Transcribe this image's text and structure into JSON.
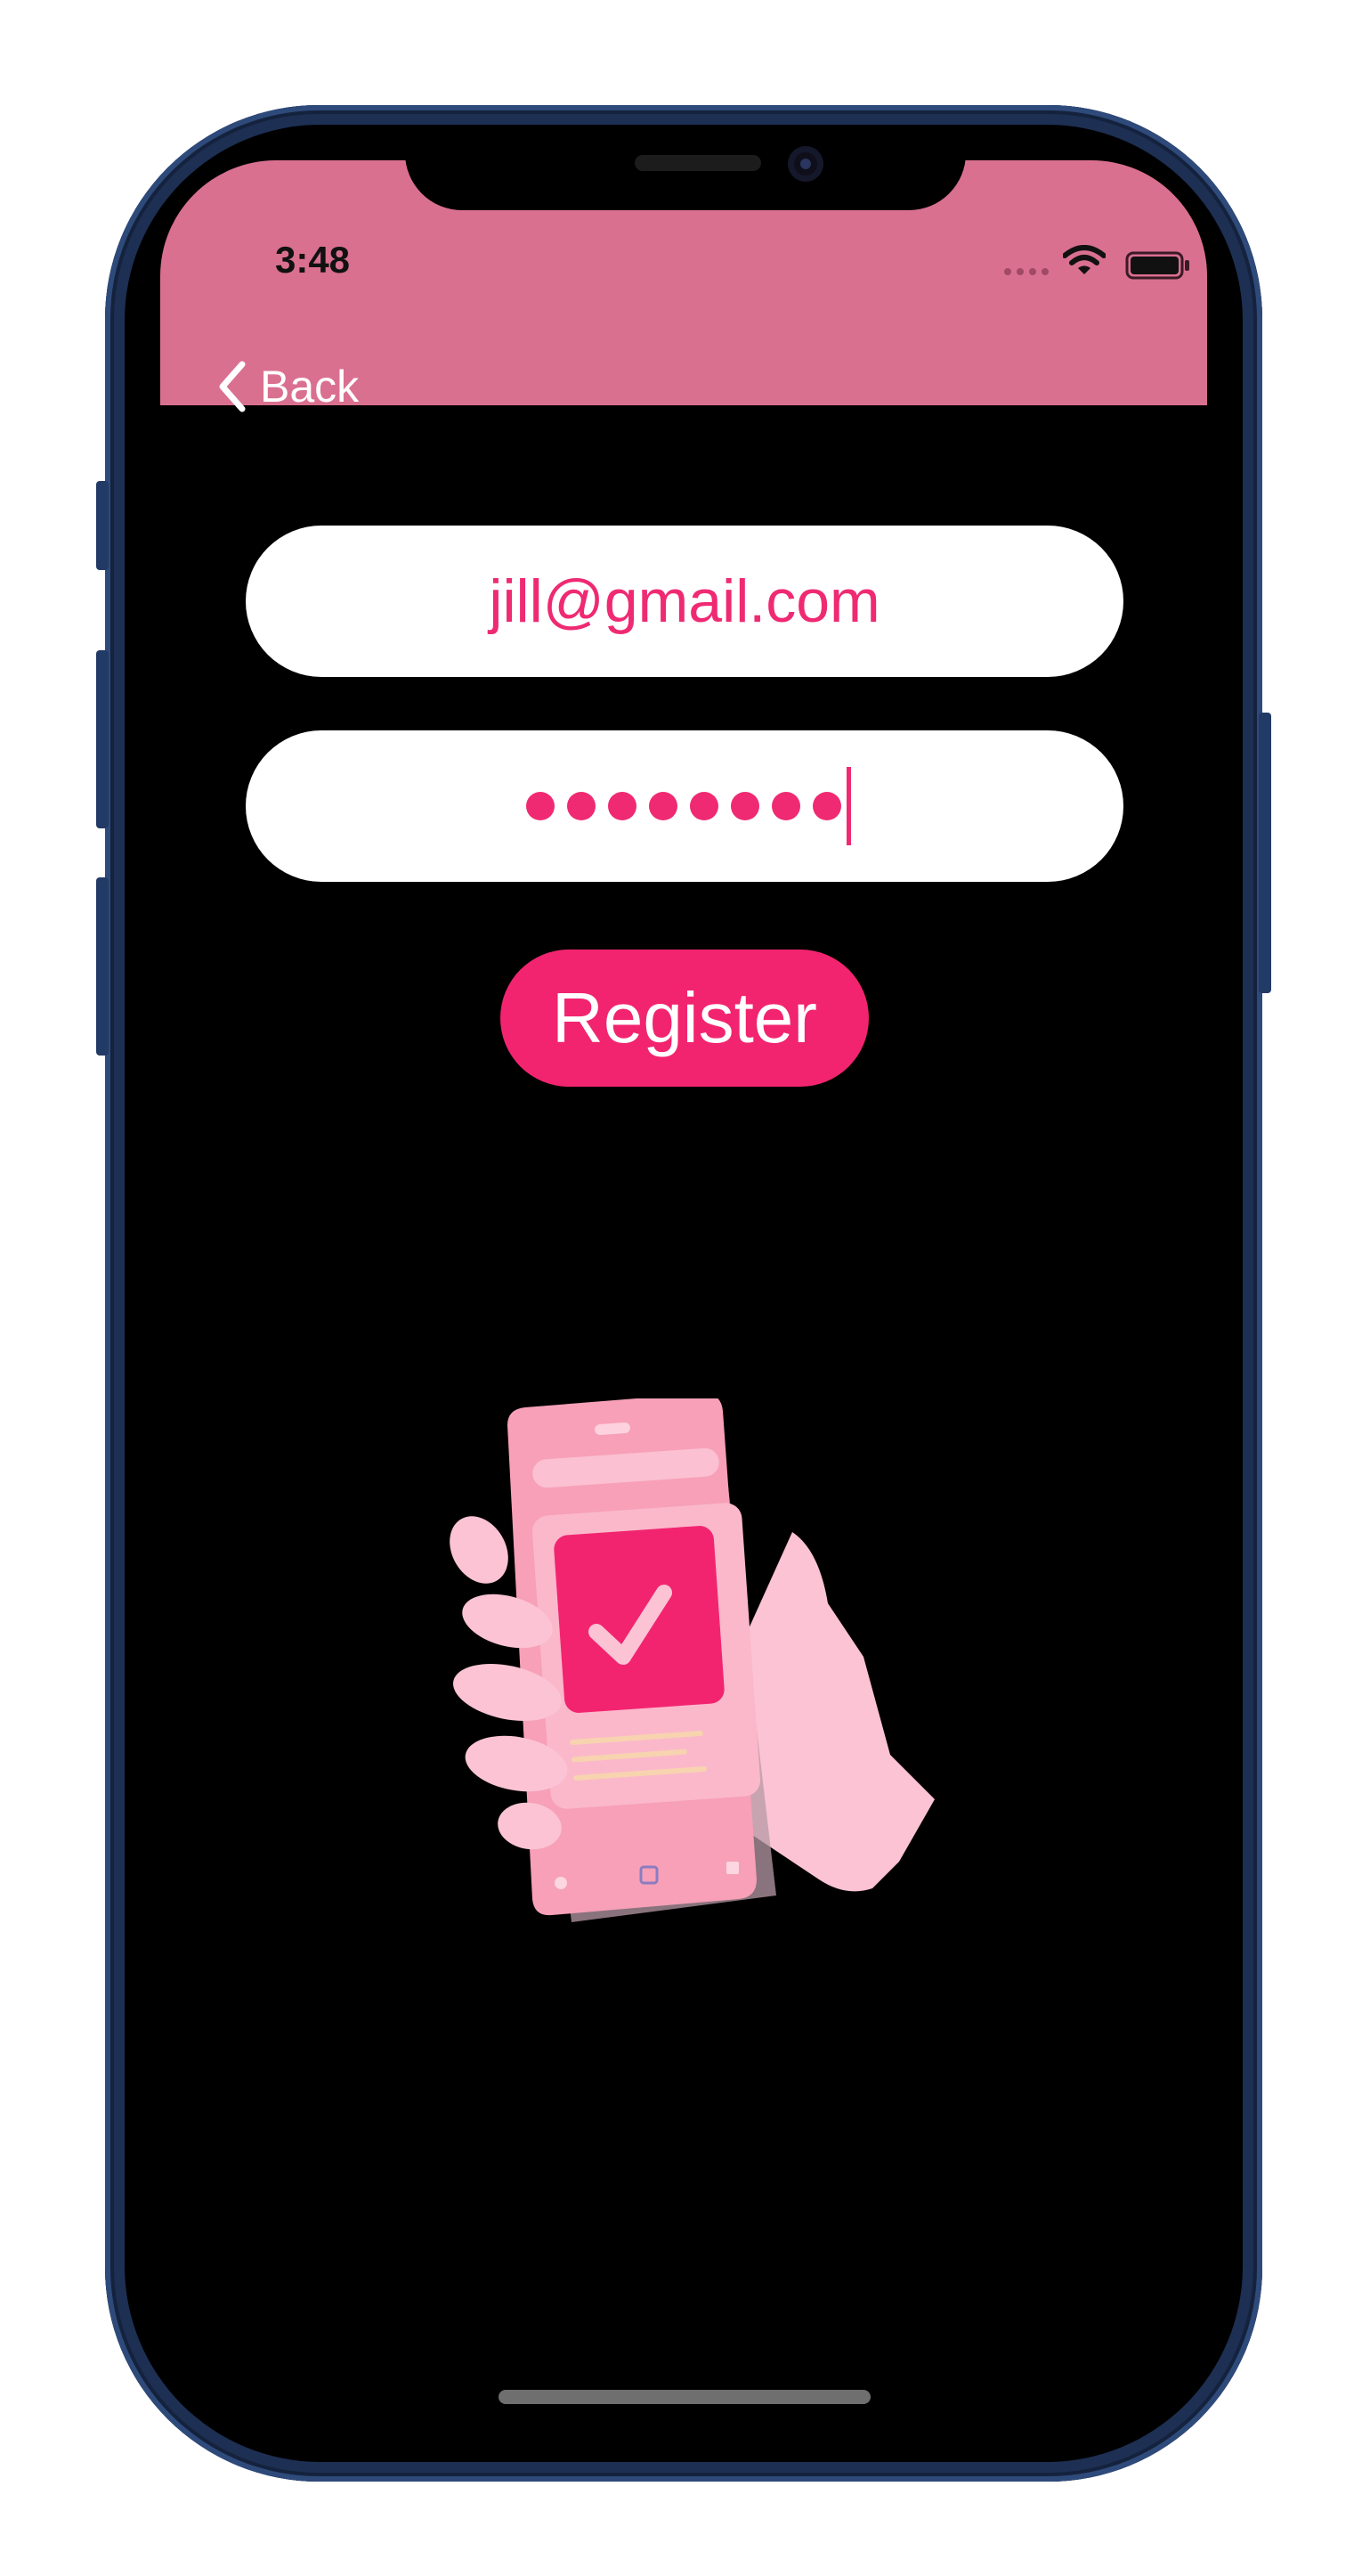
{
  "status_bar": {
    "time": "3:48"
  },
  "nav": {
    "back_label": "Back"
  },
  "form": {
    "email_value": "jill@gmail.com",
    "password_masked_length": 8,
    "register_label": "Register"
  },
  "colors": {
    "header": "#da7090",
    "accent": "#ef2a72",
    "background": "#000000"
  },
  "icons": [
    "chevron-left-icon",
    "wifi-icon",
    "battery-icon",
    "phone-checkmark-illustration"
  ]
}
